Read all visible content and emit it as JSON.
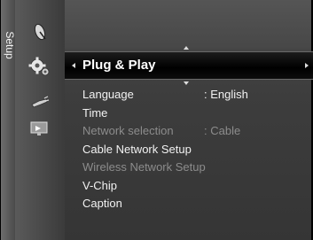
{
  "menu": {
    "category": "Setup",
    "selected": "Plug & Play",
    "items": [
      {
        "label": "Language",
        "value": ": English",
        "enabled": true
      },
      {
        "label": "Time",
        "value": "",
        "enabled": true
      },
      {
        "label": "Network selection",
        "value": ": Cable",
        "enabled": false
      },
      {
        "label": "Cable Network Setup",
        "value": "",
        "enabled": true
      },
      {
        "label": "Wireless Network Setup",
        "value": "",
        "enabled": false
      },
      {
        "label": "V-Chip",
        "value": "",
        "enabled": true
      },
      {
        "label": "Caption",
        "value": "",
        "enabled": true
      }
    ]
  },
  "icons": [
    "satellite-dish-icon",
    "gear-icon",
    "plug-icon",
    "input-icon"
  ],
  "colors": {
    "text": "#f2f2f2",
    "disabled_text": "#8c8c8c",
    "highlight_bg": "#000000"
  }
}
